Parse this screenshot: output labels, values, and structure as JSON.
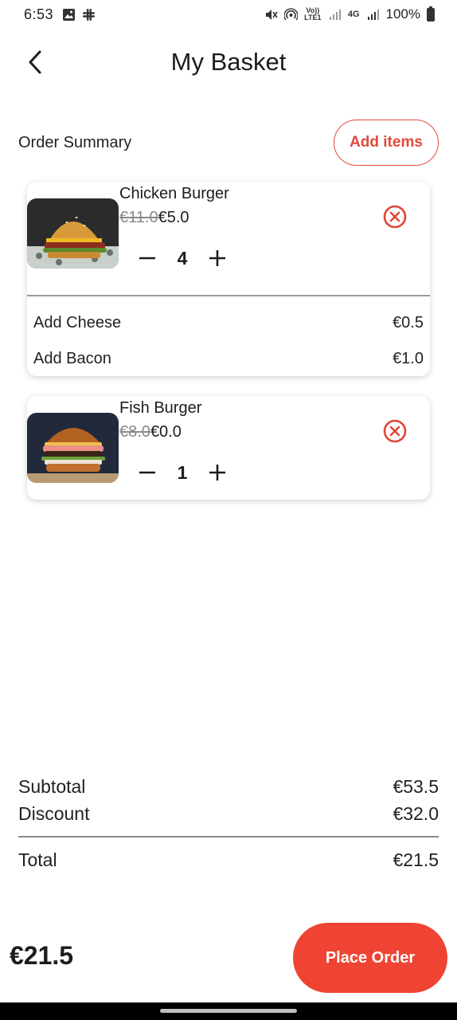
{
  "status_bar": {
    "time": "6:53",
    "battery": "100%",
    "network_label_1": "Vo)) LTE1",
    "network_label_2": "4G"
  },
  "header": {
    "title": "My Basket",
    "back_icon": "chevron-left-icon"
  },
  "summary": {
    "label": "Order Summary",
    "add_items_label": "Add items"
  },
  "items": [
    {
      "name": "Chicken Burger",
      "old_price": "€11.0",
      "new_price": "€5.0",
      "quantity": "4",
      "addons": [
        {
          "name": "Add Cheese",
          "price": "€0.5"
        },
        {
          "name": "Add Bacon",
          "price": "€1.0"
        }
      ]
    },
    {
      "name": "Fish Burger",
      "old_price": "€8.0",
      "new_price": "€0.0",
      "quantity": "1",
      "addons": []
    }
  ],
  "totals": {
    "subtotal_label": "Subtotal",
    "subtotal_value": "€53.5",
    "discount_label": "Discount",
    "discount_value": "€32.0",
    "total_label": "Total",
    "total_value": "€21.5"
  },
  "footer": {
    "total": "€21.5",
    "place_order_label": "Place Order"
  },
  "colors": {
    "accent": "#ef4433",
    "accent_outline": "#e24a3c",
    "remove_icon": "#e0463a"
  }
}
